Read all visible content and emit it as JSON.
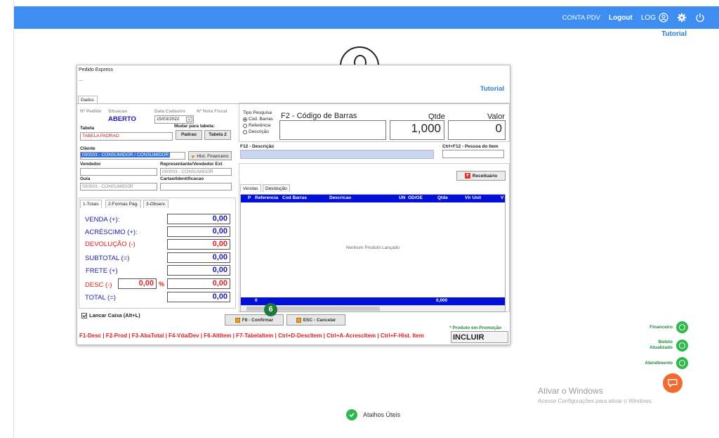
{
  "topbar": {
    "conta": "CONTA PDV",
    "logout": "Logout",
    "log": "LOG",
    "tutorial": "Tutorial"
  },
  "window": {
    "title": "Pedido Express",
    "subtitle": "...",
    "tutorial": "Tutorial",
    "tab": "Dados"
  },
  "header": {
    "pedido_l": "Nº Pedido",
    "situacao_l": "Situacao",
    "situacao_v": "ABERTO",
    "data_l": "Data Cadastro",
    "data_v": "15/03/2022",
    "nota_l": "Nº Nota Fiscal",
    "tabela_l": "Tabela",
    "mudar_l": "Mudar para tabela:",
    "tabela_v": "TABELA PADRAO",
    "padrao_btn": "Padrao",
    "tabela2_btn": "Tabela 2",
    "cliente_l": "Cliente",
    "cliente_v": "000003 - CONSUMIDOR / CONSUMIDOR",
    "hist_btn": "Hist. Financeiro",
    "vendedor_l": "Vendedor",
    "repr_l": "Representante/Vendedor Ext",
    "repr_v": "000003 - CONSUMIDOR",
    "guia_l": "Guia",
    "guia_v": "000003 - CONSUMIDOR",
    "cartao_l": "Cartao/Identificacao"
  },
  "search": {
    "tipo_l": "Tipo Pesquisa",
    "opt1": "Cod. Barras",
    "opt2": "Referência",
    "opt3": "Descrição",
    "f2_l": "F2 - Código de Barras",
    "qtde_l": "Qtde",
    "qtde_v": "1,000",
    "valor_l": "Valor",
    "valor_v": "0",
    "desc_l": "F12 - Descrição",
    "ctrl_l": "Ctrl+F12 - Pessoa do Item",
    "receit_btn": "Receituário"
  },
  "grid": {
    "tab1": "Vendas",
    "tab2": "Devolução",
    "cols": [
      "P",
      "Referencia",
      "Cod Barras",
      "Descricao",
      "UN",
      "OD/OE",
      "Qtde",
      "Vlr Unit",
      "V"
    ],
    "empty": "Nenhum Produto Lançado",
    "foot_count": "0",
    "foot_total": "0,000"
  },
  "totals": {
    "tab1": "1-Totais",
    "tab2": "2-Formas Pag.",
    "tab3": "3-Observ.",
    "venda_l": "VENDA (+):",
    "venda_v": "0,00",
    "acresc_l": "ACRÉSCIMO (+):",
    "acresc_v": "0,00",
    "devol_l": "DEVOLUÇÃO (-)",
    "devol_v": "0,00",
    "subtotal_l": "SUBTOTAL (=)",
    "subtotal_v": "0,00",
    "frete_l": "FRETE (+)",
    "frete_v": "0,00",
    "desc_l": "DESC (-)",
    "desc_pct": "0,00",
    "pct_sign": "%",
    "desc_v": "0,00",
    "total_l": "TOTAL (=)",
    "total_v": "0,00"
  },
  "footer": {
    "lancar": "Lancar Caixa (Alt+L)",
    "confirmar": "F8 - Confirmar",
    "cancelar": "ESC - Cancelar",
    "badge": "6",
    "promo": "* Produto em Promoção",
    "shortcuts": "F1-Desc | F2-Prod | F3-AbaTotal | F4-Vda/Dev | F6-AltItem | F7-TabelaItem | Ctrl+D-DescItem | Ctrl+A-AcrescItem | Ctrl+F-Hist. Item",
    "incluir": "INCLUIR"
  },
  "side": {
    "financeiro": "Financeiro",
    "boleto1": "Boleto",
    "boleto2": "Atualizado",
    "atendimento": "Atendimento"
  },
  "windows_activation": {
    "line1": "Ativar o Windows",
    "line2": "Acesse Configurações para ativar o Windows."
  },
  "atalhos": "Atalhos Úteis",
  "colors": {
    "topbar": "#3d8ef0",
    "grid_header": "#0010d8",
    "red": "#e02020",
    "blue_text": "#1a1ab0",
    "green": "#2fb84c",
    "orange": "#f26a2e"
  }
}
